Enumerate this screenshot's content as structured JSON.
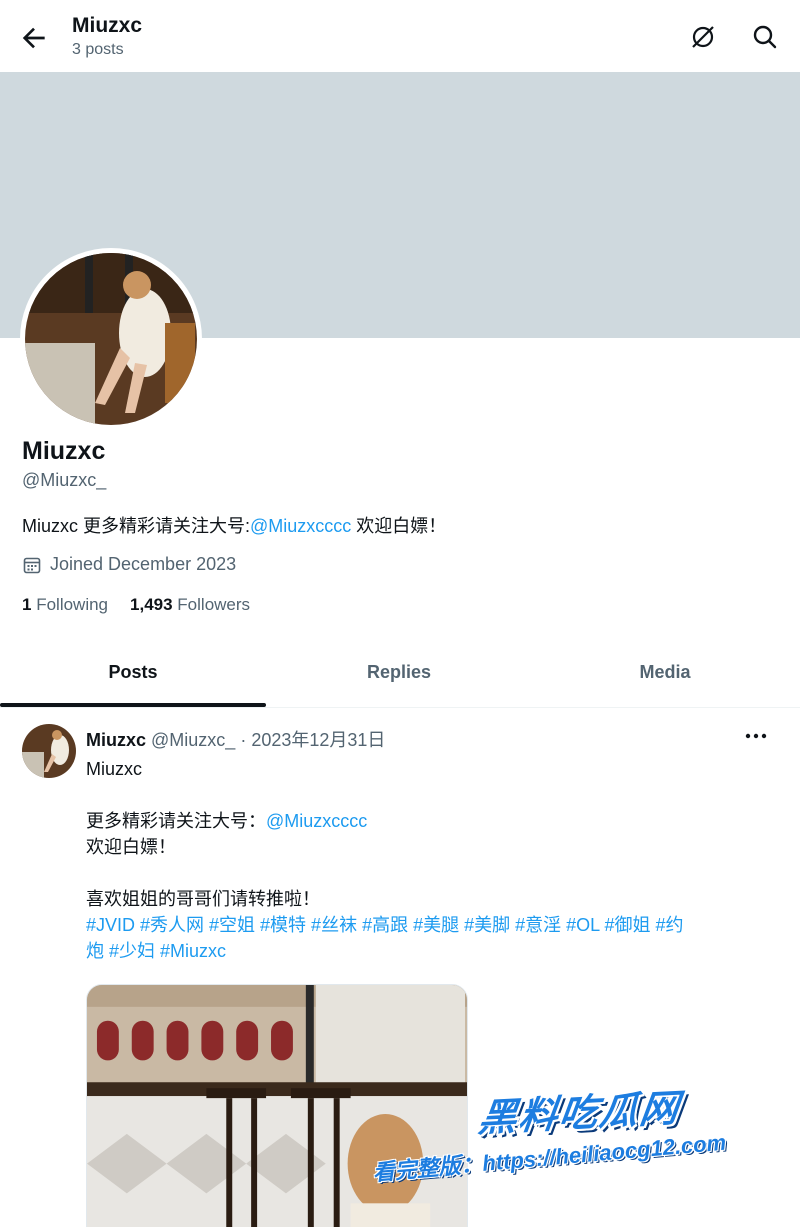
{
  "header": {
    "title": "Miuzxc",
    "subtitle": "3 posts",
    "back_icon": "arrow-left-icon",
    "notifications_icon": "notifications-off-icon",
    "search_icon": "search-icon"
  },
  "profile": {
    "name": "Miuzxc",
    "handle": "@Miuzxc_",
    "bio_prefix": "Miuzxc 更多精彩请关注大号:",
    "bio_link": "@Miuzxcccc",
    "bio_suffix": " 欢迎白嫖！",
    "joined": "Joined December 2023",
    "following_count": "1",
    "following_label": "Following",
    "followers_count": "1,493",
    "followers_label": "Followers",
    "banner_color": "#cfd9de"
  },
  "tabs": [
    {
      "label": "Posts",
      "active": true
    },
    {
      "label": "Replies",
      "active": false
    },
    {
      "label": "Media",
      "active": false
    }
  ],
  "tweet": {
    "name": "Miuzxc",
    "handle": "@Miuzxc_",
    "separator": " · ",
    "date": "2023年12月31日",
    "line1": "Miuzxc",
    "line2_prefix": "更多精彩请关注大号：",
    "line2_link": "@Miuzxcccc",
    "line3": "欢迎白嫖！",
    "line4": "喜欢姐姐的哥哥们请转推啦！",
    "hashtags_line1": "#JVID #秀人网 #空姐 #模特 #丝袜 #高跟 #美腿 #美脚 #意淫 #OL #御姐 #约",
    "hashtags_line2": "炮 #少妇 #Miuzxc",
    "more_icon": "more-horizontal-icon"
  },
  "watermark": {
    "title": "黑料吃瓜网",
    "line": "看完整版：https://heiliaocg12.com"
  },
  "colors": {
    "accent": "#1d9bf0",
    "text": "#0f1419",
    "muted": "#536471"
  }
}
